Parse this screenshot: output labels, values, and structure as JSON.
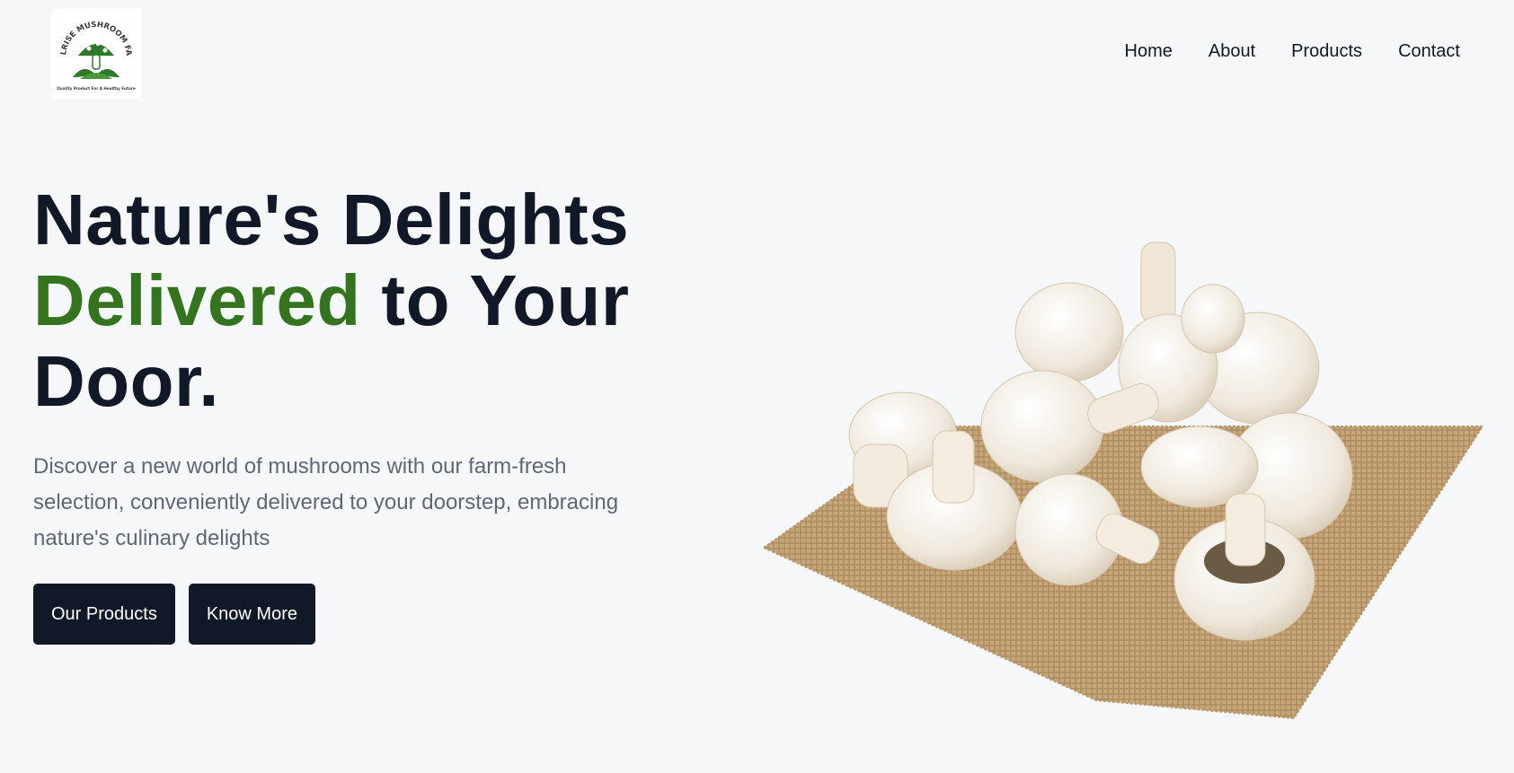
{
  "brand": {
    "logo_text": "HILLRISE MUSHROOM FARM",
    "logo_tagline": "Quality Product For A Healthy Future"
  },
  "nav": {
    "items": [
      {
        "label": "Home"
      },
      {
        "label": "About"
      },
      {
        "label": "Products"
      },
      {
        "label": "Contact"
      }
    ]
  },
  "hero": {
    "headline_line1": "Nature's Delights",
    "headline_accent": "Delivered",
    "headline_line2_rest": " to Your",
    "headline_line3": "Door.",
    "subtitle": "Discover a new world of mushrooms with our farm-fresh selection, conveniently delivered to your doorstep, embracing nature's culinary delights",
    "primary_button": "Our Products",
    "secondary_button": "Know More"
  },
  "colors": {
    "background": "#f6f7f9",
    "text_dark": "#111827",
    "accent_green": "#34741f",
    "subtitle_gray": "#5f6777"
  }
}
